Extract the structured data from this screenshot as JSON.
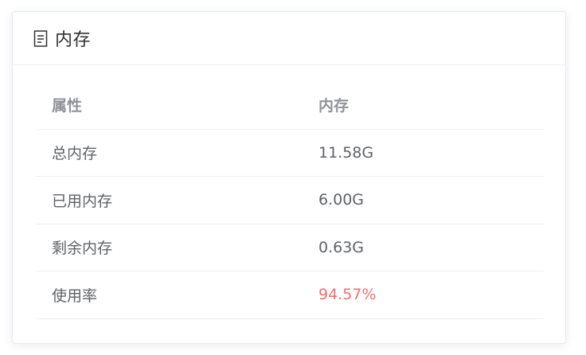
{
  "card": {
    "title": "内存",
    "icon": "document-icon"
  },
  "table": {
    "headers": [
      "属性",
      "内存"
    ],
    "rows": [
      {
        "label": "总内存",
        "value": "11.58G",
        "status": "normal"
      },
      {
        "label": "已用内存",
        "value": "6.00G",
        "status": "normal"
      },
      {
        "label": "剩余内存",
        "value": "0.63G",
        "status": "normal"
      },
      {
        "label": "使用率",
        "value": "94.57%",
        "status": "danger"
      }
    ]
  },
  "colors": {
    "danger": "#f56c6c",
    "header_text": "#909399",
    "body_text": "#606266"
  }
}
